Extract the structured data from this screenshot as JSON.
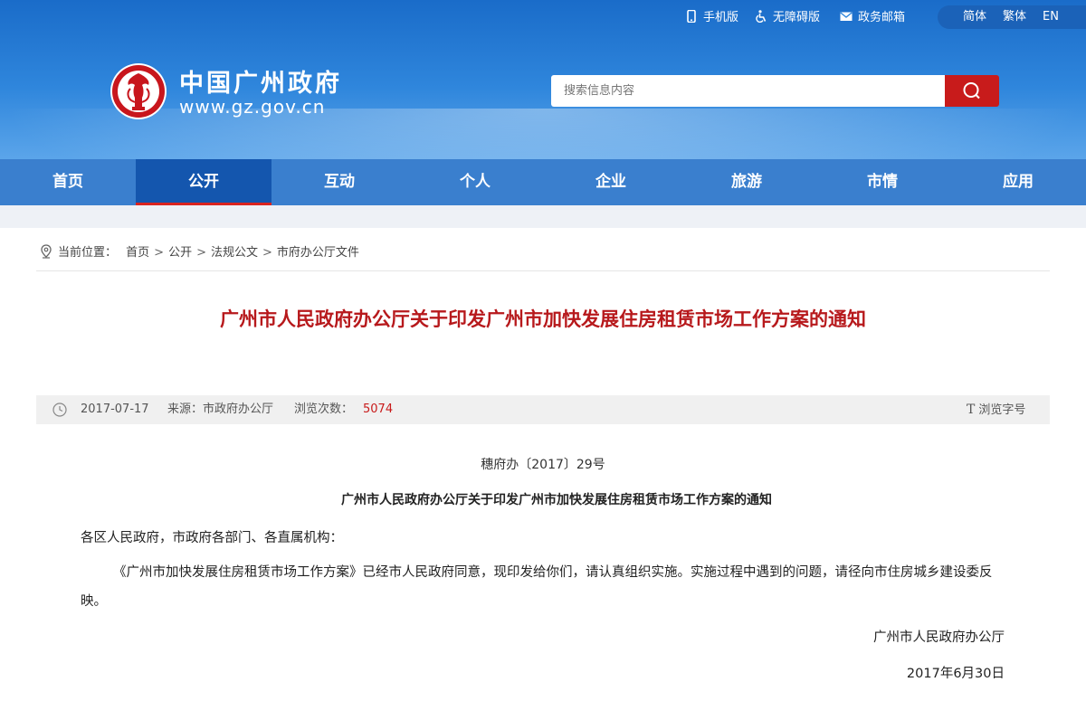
{
  "topbar": {
    "mobile": "手机版",
    "accessible": "无障碍版",
    "email": "政务邮箱",
    "lang": [
      "简体",
      "繁体",
      "EN"
    ]
  },
  "brand": {
    "name": "中国广州政府",
    "url": "www.gz.gov.cn"
  },
  "search": {
    "placeholder": "搜索信息内容"
  },
  "nav": [
    "首页",
    "公开",
    "互动",
    "个人",
    "企业",
    "旅游",
    "市情",
    "应用"
  ],
  "nav_active": "公开",
  "breadcrumb": {
    "label": "当前位置：",
    "items": [
      "首页",
      "公开",
      "法规公文",
      "市府办公厅文件"
    ]
  },
  "article": {
    "title": "广州市人民政府办公厅关于印发广州市加快发展住房租赁市场工作方案的通知",
    "date": "2017-07-17",
    "source": "来源：市政府办公厅",
    "views_label": "浏览次数：",
    "views": "5074",
    "font_size_label": "浏览字号",
    "doc_number": "穗府办〔2017〕29号",
    "heading": "广州市人民政府办公厅关于印发广州市加快发展住房租赁市场工作方案的通知",
    "salutation": "各区人民政府，市政府各部门、各直属机构：",
    "body": "《广州市加快发展住房租赁市场工作方案》已经市人民政府同意，现印发给你们，请认真组织实施。实施过程中遇到的问题，请径向市住房城乡建设委反映。",
    "signature": "广州市人民政府办公厅",
    "sign_date": "2017年6月30日"
  },
  "colors": {
    "header_blue": "#2f86dc",
    "nav_blue": "#3a7fce",
    "nav_active": "#1456ae",
    "accent_red": "#c81b1b",
    "title_red": "#b7191c"
  }
}
